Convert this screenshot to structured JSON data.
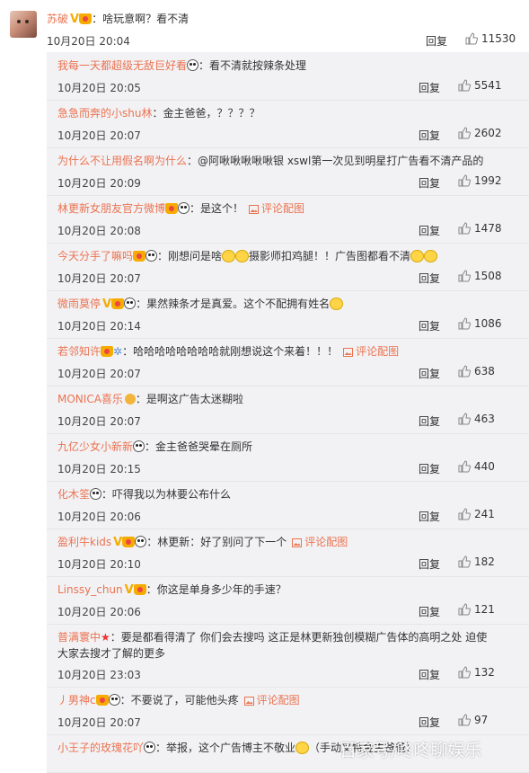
{
  "main": {
    "user": "苏破",
    "text": "：啥玩意啊？看不清",
    "time": "10月20日 20:04",
    "reply": "回复",
    "likes": "11530"
  },
  "replies": [
    {
      "user": "我每一天都超级无敌巨好看",
      "text": "：看不清就按辣条处理",
      "time": "10月20日 20:05",
      "reply": "回复",
      "likes": "5541"
    },
    {
      "user": "急急而奔的小shu林",
      "text": "：金主爸爸，？？？？",
      "time": "10月20日 20:07",
      "reply": "回复",
      "likes": "2602"
    },
    {
      "user": "为什么不让用假名啊为什么",
      "text": "：@阿啾啾啾啾啾银 xswl第一次见到明星打广告看不清产品的",
      "time": "10月20日 20:09",
      "reply": "回复",
      "likes": "1992"
    },
    {
      "user": "林更新女朋友官方微博",
      "text": "：是这个！",
      "pic": "评论配图",
      "time": "10月20日 20:08",
      "reply": "回复",
      "likes": "1478"
    },
    {
      "user": "今天分手了嘛吗",
      "text": "：刚想问是啥",
      "text2": "摄影师扣鸡腿！！广告图都看不清",
      "time": "10月20日 20:07",
      "reply": "回复",
      "likes": "1508"
    },
    {
      "user": "微雨莫停",
      "text": "：果然辣条才是真爱。这个不配拥有姓名",
      "time": "10月20日 20:14",
      "reply": "回复",
      "likes": "1086"
    },
    {
      "user": "若邻知许",
      "text": "：哈哈哈哈哈哈哈哈就刚想说这个来着！！！",
      "pic": "评论配图",
      "time": "10月20日 20:07",
      "reply": "回复",
      "likes": "638"
    },
    {
      "user": "MONICA喜乐",
      "text": "：是啊这广告太迷糊啦",
      "time": "10月20日 20:07",
      "reply": "回复",
      "likes": "463"
    },
    {
      "user": "九亿少女小新新",
      "text": "：金主爸爸哭晕在厕所",
      "time": "10月20日 20:15",
      "reply": "回复",
      "likes": "440"
    },
    {
      "user": "化木筌",
      "text": "：吓得我以为林要公布什么",
      "time": "10月20日 20:06",
      "reply": "回复",
      "likes": "241"
    },
    {
      "user": "盈利牛kids",
      "text": "：林更新：好了别问了下一个",
      "pic": "评论配图",
      "time": "10月20日 20:10",
      "reply": "回复",
      "likes": "182"
    },
    {
      "user": "Linssy_chun",
      "text": "：你这是单身多少年的手速？",
      "time": "10月20日 20:06",
      "reply": "回复",
      "likes": "121"
    },
    {
      "user": "普满寰中",
      "text": "：要是都看得清了 你们会去搜吗   这正是林更新独创模糊广告体的高明之处 迫使",
      "text2": "大家去搜才了解的更多",
      "time": "10月20日 23:03",
      "reply": "回复",
      "likes": "132"
    },
    {
      "user": "丿男神c",
      "text": "：不要说了，可能他头疼",
      "pic": "评论配图",
      "time": "10月20日 20:07",
      "reply": "回复",
      "likes": "97"
    },
    {
      "user": "小王子的玫瑰花吖",
      "text": "：举报，这个广告博主不敬业",
      "text2": "（手动叉特金主爸爸）",
      "time": "",
      "reply": "",
      "likes": ""
    }
  ],
  "watermark": "百家号/咚咚聊娱乐",
  "icons": {
    "like": "thumbs-up-icon",
    "pic": "image-icon"
  }
}
